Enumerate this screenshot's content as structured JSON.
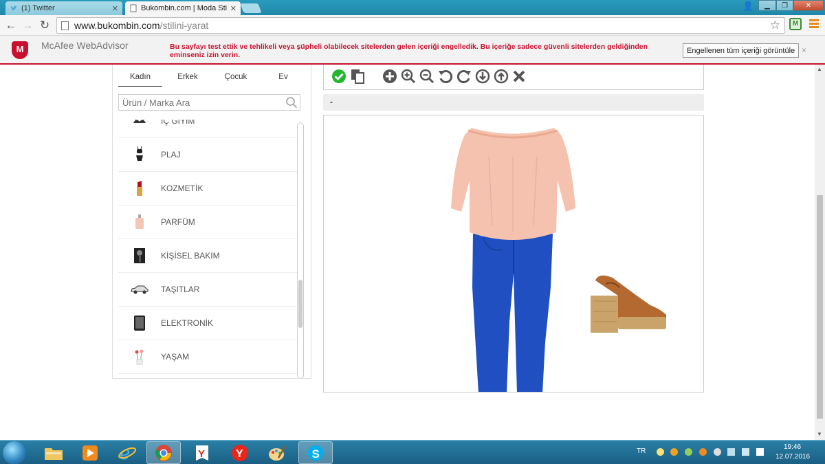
{
  "browser": {
    "tabs": [
      {
        "title": "(1) Twitter",
        "active": false
      },
      {
        "title": "Bukombin.com | Moda Sti",
        "active": true
      }
    ],
    "url_host": "www.bukombin.com",
    "url_path": "/stilini-yarat"
  },
  "mcafee": {
    "brand": "McAfee WebAdvisor",
    "message": "Bu sayfayı test ettik ve tehlikeli veya şüpheli olabilecek sitelerden gelen içeriği engelledik. Bu içeriğe sadece güvenli sitelerden geldiğinden eminseniz izin verin.",
    "button": "Engellenen tüm içeriği görüntüle",
    "close": "×"
  },
  "sidebar": {
    "tabs": [
      "Kadın",
      "Erkek",
      "Çocuk",
      "Ev"
    ],
    "active_tab": "Kadın",
    "search_placeholder": "Ürün / Marka Ara",
    "categories": [
      {
        "label": "İÇ GİYİM",
        "icon": "lingerie"
      },
      {
        "label": "PLAJ",
        "icon": "swimsuit"
      },
      {
        "label": "KOZMETİK",
        "icon": "lipstick"
      },
      {
        "label": "PARFÜM",
        "icon": "perfume"
      },
      {
        "label": "KİŞİSEL BAKIM",
        "icon": "hair-dryer"
      },
      {
        "label": "TAŞITLAR",
        "icon": "car"
      },
      {
        "label": "ELEKTRONİK",
        "icon": "tablet"
      },
      {
        "label": "YAŞAM",
        "icon": "flowers"
      }
    ]
  },
  "editor": {
    "caption": "-",
    "tools": [
      "check-icon",
      "copy-icon",
      "add-icon",
      "zoom-in-icon",
      "zoom-out-icon",
      "rotate-left-icon",
      "rotate-right-icon",
      "move-down-icon",
      "move-up-icon",
      "delete-icon"
    ],
    "items": [
      "pink blouse",
      "blue jeans",
      "tan sandal"
    ]
  },
  "taskbar": {
    "language": "TR",
    "time": "19:46",
    "date": "12.07.2016",
    "apps": [
      "explorer",
      "media-player",
      "internet-explorer",
      "chrome",
      "yandex-browser",
      "yandex",
      "paint",
      "skype"
    ]
  },
  "colors": {
    "mcafee_red": "#c8102e",
    "check_green": "#22b52d",
    "taskbar_blue": "#1b5f84"
  }
}
